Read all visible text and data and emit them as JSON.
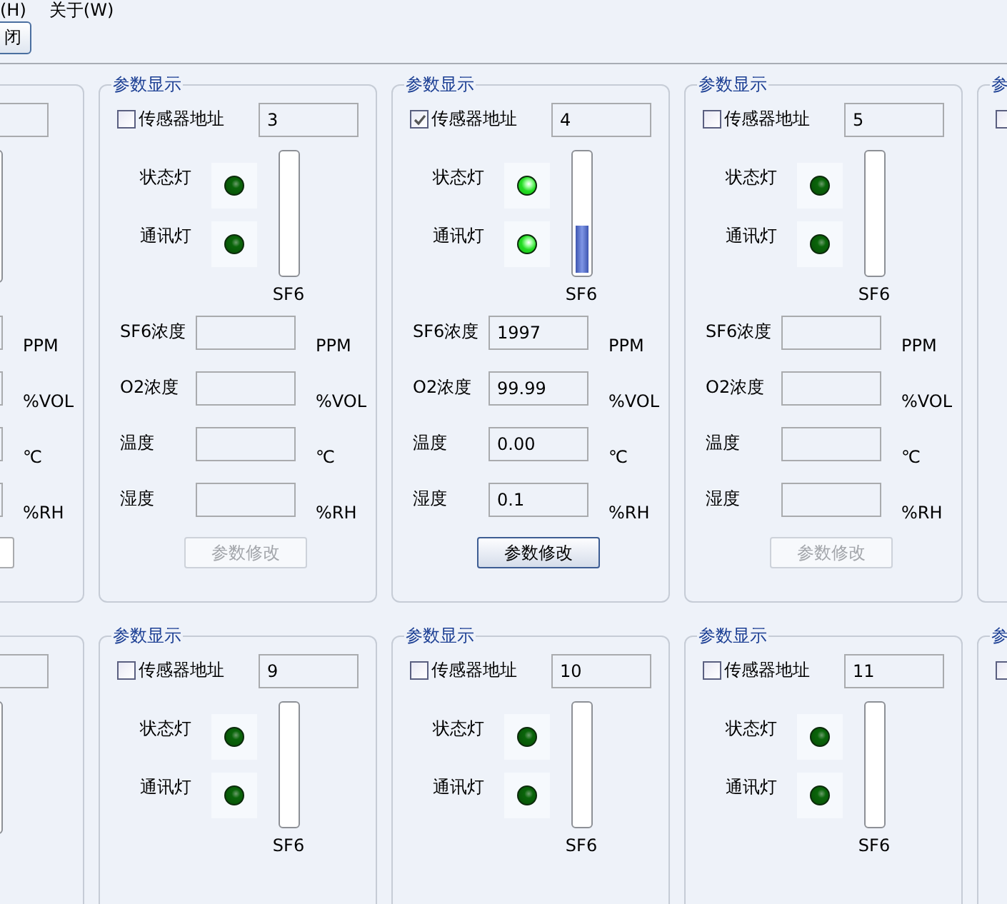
{
  "menu": [
    {
      "label": "(H)"
    },
    {
      "label": "关于(W)"
    }
  ],
  "toolbar": {
    "button": "闭"
  },
  "rows": [
    {
      "panels": [
        {
          "kind": "edge-left",
          "readings": [
            {
              "unit": "PPM"
            },
            {
              "unit": "%VOL"
            },
            {
              "unit": "℃"
            },
            {
              "unit": "%RH"
            }
          ]
        },
        {
          "kind": "full",
          "title": "参数显示",
          "checkbox": {
            "label": "传感器地址",
            "checked": false
          },
          "address": "3",
          "lamps": [
            {
              "label": "状态灯",
              "on": false
            },
            {
              "label": "通讯灯",
              "on": false
            }
          ],
          "gauge": {
            "label": "SF6",
            "level": 0
          },
          "readings": [
            {
              "label": "SF6浓度",
              "unit": "PPM"
            },
            {
              "label": "O2浓度",
              "unit": "%VOL"
            },
            {
              "label": "温度",
              "unit": "℃"
            },
            {
              "label": "湿度",
              "unit": "%RH"
            }
          ],
          "button": {
            "label": "参数修改",
            "disabled": true
          }
        },
        {
          "kind": "full",
          "title": "参数显示",
          "checkbox": {
            "label": "传感器地址",
            "checked": true
          },
          "address": "4",
          "lamps": [
            {
              "label": "状态灯",
              "on": true
            },
            {
              "label": "通讯灯",
              "on": true
            }
          ],
          "gauge": {
            "label": "SF6",
            "level": 0.4
          },
          "readings": [
            {
              "label": "SF6浓度",
              "value": "1997",
              "unit": "PPM"
            },
            {
              "label": "O2浓度",
              "value": "99.99",
              "unit": "%VOL"
            },
            {
              "label": "温度",
              "value": "0.00",
              "unit": "℃"
            },
            {
              "label": "湿度",
              "value": "0.1",
              "unit": "%RH"
            }
          ],
          "button": {
            "label": "参数修改",
            "disabled": false
          }
        },
        {
          "kind": "full",
          "title": "参数显示",
          "checkbox": {
            "label": "传感器地址",
            "checked": false
          },
          "address": "5",
          "lamps": [
            {
              "label": "状态灯",
              "on": false
            },
            {
              "label": "通讯灯",
              "on": false
            }
          ],
          "gauge": {
            "label": "SF6",
            "level": 0
          },
          "readings": [
            {
              "label": "SF6浓度",
              "unit": "PPM"
            },
            {
              "label": "O2浓度",
              "unit": "%VOL"
            },
            {
              "label": "温度",
              "unit": "℃"
            },
            {
              "label": "湿度",
              "unit": "%RH"
            }
          ],
          "button": {
            "label": "参数修改",
            "disabled": true
          }
        },
        {
          "kind": "edge-right",
          "title": "参",
          "checkbox": {
            "checked": false
          }
        }
      ]
    },
    {
      "panels": [
        {
          "kind": "edge-left"
        },
        {
          "kind": "full",
          "title": "参数显示",
          "checkbox": {
            "label": "传感器地址",
            "checked": false
          },
          "address": "9",
          "lamps": [
            {
              "label": "状态灯",
              "on": false
            },
            {
              "label": "通讯灯",
              "on": false
            }
          ],
          "gauge": {
            "label": "SF6",
            "level": 0
          }
        },
        {
          "kind": "full",
          "title": "参数显示",
          "checkbox": {
            "label": "传感器地址",
            "checked": false
          },
          "address": "10",
          "lamps": [
            {
              "label": "状态灯",
              "on": false
            },
            {
              "label": "通讯灯",
              "on": false
            }
          ],
          "gauge": {
            "label": "SF6",
            "level": 0
          }
        },
        {
          "kind": "full",
          "title": "参数显示",
          "checkbox": {
            "label": "传感器地址",
            "checked": false
          },
          "address": "11",
          "lamps": [
            {
              "label": "状态灯",
              "on": false
            },
            {
              "label": "通讯灯",
              "on": false
            }
          ],
          "gauge": {
            "label": "SF6",
            "level": 0
          }
        },
        {
          "kind": "edge-right",
          "title": "参",
          "checkbox": {
            "checked": false
          }
        }
      ]
    }
  ]
}
